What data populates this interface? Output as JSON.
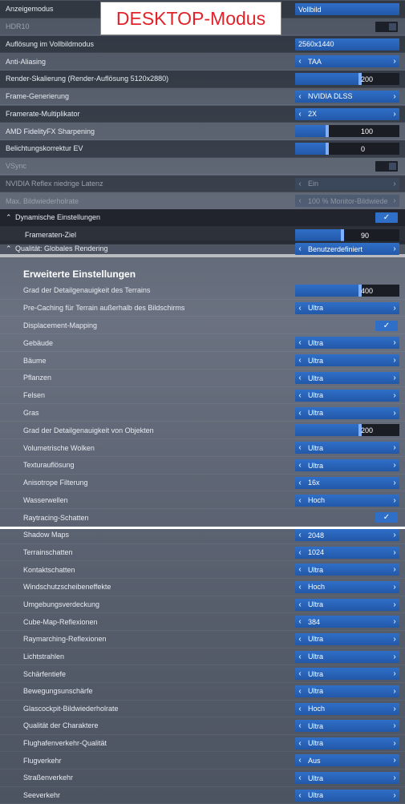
{
  "banner": "DESKTOP-Modus",
  "top_rows": [
    {
      "label": "Anzeigemodus",
      "type": "select-plain",
      "value": "Vollbild"
    },
    {
      "label": "HDR10",
      "type": "toggle-off",
      "dim": true
    },
    {
      "label": "Auflösung im Vollbildmodus",
      "type": "select-plain",
      "value": "2560x1440"
    },
    {
      "label": "Anti-Aliasing",
      "type": "select",
      "value": "TAA"
    },
    {
      "label": "Render-Skalierung (Render-Auflösung 5120x2880)",
      "type": "slider",
      "value": "200",
      "level": 0.62
    },
    {
      "label": "Frame-Generierung",
      "type": "select",
      "value": "NVIDIA DLSS"
    },
    {
      "label": "Framerate-Multiplikator",
      "type": "select",
      "value": "2X"
    },
    {
      "label": "AMD FidelityFX Sharpening",
      "type": "slider",
      "value": "100",
      "level": 0.31
    },
    {
      "label": "Belichtungskorrektur EV",
      "type": "slider",
      "value": "0",
      "level": 0.31
    },
    {
      "label": "VSync",
      "type": "toggle-off",
      "dim": true
    },
    {
      "label": "NVIDIA Reflex niedrige Latenz",
      "type": "select-dim",
      "value": "Ein",
      "dim": true
    },
    {
      "label": "Max. Bildwiederholrate",
      "type": "select-dim",
      "value": "100 % Monitor-Bildwiede",
      "dim": true
    }
  ],
  "dyn": {
    "label": "Dynamische Einstellungen",
    "check": "✓"
  },
  "frameraten": {
    "label": "Frameraten-Ziel",
    "value": "90",
    "level": 0.45
  },
  "quality": {
    "label": "Qualität: Globales Rendering",
    "value": "Benutzerdefiniert"
  },
  "section_title": "Erweiterte Einstellungen",
  "adv_rows": [
    {
      "label": "Grad der Detailgenauigkeit des Terrains",
      "type": "slider",
      "value": "400",
      "level": 0.62
    },
    {
      "label": "Pre-Caching für Terrain außerhalb des Bildschirms",
      "type": "select",
      "value": "Ultra"
    },
    {
      "label": "Displacement-Mapping",
      "type": "check"
    },
    {
      "label": "Gebäude",
      "type": "select",
      "value": "Ultra"
    },
    {
      "label": "Bäume",
      "type": "select",
      "value": "Ultra"
    },
    {
      "label": "Pflanzen",
      "type": "select",
      "value": "Ultra"
    },
    {
      "label": "Felsen",
      "type": "select",
      "value": "Ultra"
    },
    {
      "label": "Gras",
      "type": "select",
      "value": "Ultra"
    },
    {
      "label": "Grad der Detailgenauigkeit von Objekten",
      "type": "slider",
      "value": "200",
      "level": 0.62
    },
    {
      "label": "Volumetrische Wolken",
      "type": "select",
      "value": "Ultra"
    },
    {
      "label": "Texturauflösung",
      "type": "select",
      "value": "Ultra"
    },
    {
      "label": "Anisotrope Filterung",
      "type": "select",
      "value": "16x"
    },
    {
      "label": "Wasserwellen",
      "type": "select",
      "value": "Hoch"
    },
    {
      "label": "Raytracing-Schatten",
      "type": "check"
    }
  ],
  "low_rows": [
    {
      "label": "Shadow Maps",
      "value": "2048"
    },
    {
      "label": "Terrainschatten",
      "value": "1024"
    },
    {
      "label": "Kontaktschatten",
      "value": "Ultra"
    },
    {
      "label": "Windschutzscheibeneffekte",
      "value": "Hoch"
    },
    {
      "label": "Umgebungsverdeckung",
      "value": "Ultra"
    },
    {
      "label": "Cube-Map-Reflexionen",
      "value": "384"
    },
    {
      "label": "Raymarching-Reflexionen",
      "value": "Ultra"
    },
    {
      "label": "Lichtstrahlen",
      "value": "Ultra"
    },
    {
      "label": "Schärfentiefe",
      "value": "Ultra"
    },
    {
      "label": "Bewegungsunschärfe",
      "value": "Ultra"
    },
    {
      "label": "Glascockpit-Bildwiederholrate",
      "value": "Hoch"
    },
    {
      "label": "Qualität der Charaktere",
      "value": "Ultra"
    },
    {
      "label": "Flughafenverkehr-Qualität",
      "value": "Ultra"
    },
    {
      "label": "Flugverkehr",
      "value": "Aus"
    },
    {
      "label": "Straßenverkehr",
      "value": "Ultra"
    },
    {
      "label": "Seeverkehr",
      "value": "Ultra"
    }
  ]
}
